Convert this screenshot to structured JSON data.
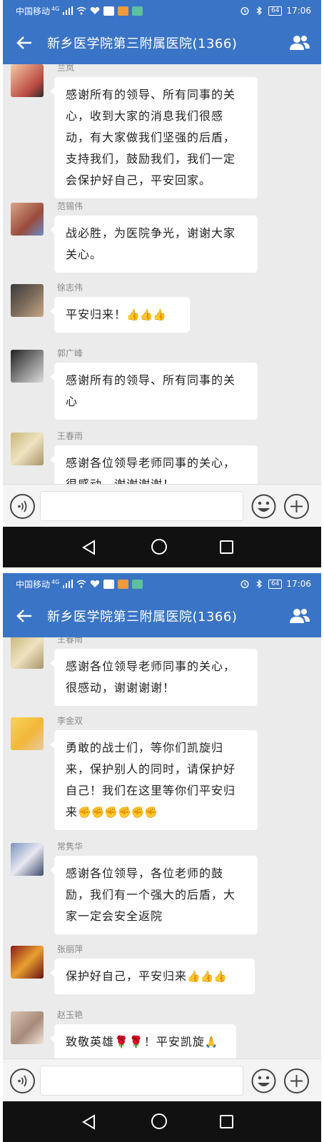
{
  "screens": [
    {
      "status": {
        "carrier": "中国移动",
        "net": "4G",
        "time": "17:06",
        "battery": "64"
      },
      "header": {
        "title": "新乡医学院第三附属医院(1366)"
      },
      "messages": [
        {
          "sender": "兰岚",
          "text": "感谢所有的领导、所有同事的关心，收到大家的消息我们很感动，有大家做我们坚强的后盾，支持我们，鼓励我们，我们一定会保护好自己，平安回家。",
          "emoji": ""
        },
        {
          "sender": "范锡伟",
          "text": "战必胜，为医院争光，谢谢大家关心。",
          "emoji": ""
        },
        {
          "sender": "徐志伟",
          "text": "平安归来！",
          "emoji": "👍👍👍"
        },
        {
          "sender": "郭广峰",
          "text": "感谢所有的领导、所有同事的关心",
          "emoji": ""
        },
        {
          "sender": "王春雨",
          "text": "感谢各位领导老师同事的关心，很感动，谢谢谢谢！",
          "emoji": ""
        }
      ]
    },
    {
      "status": {
        "carrier": "中国移动",
        "net": "4G",
        "time": "17:06",
        "battery": "64"
      },
      "header": {
        "title": "新乡医学院第三附属医院(1366)"
      },
      "messages": [
        {
          "sender": "王春雨",
          "text": "感谢各位领导老师同事的关心，很感动，谢谢谢谢！",
          "emoji": ""
        },
        {
          "sender": "李金双",
          "text": "勇敢的战士们，等你们凯旋归来，保护别人的同时，请保护好自己！我们在这里等你们平安归来",
          "emoji": "✊✊✊✊✊✊"
        },
        {
          "sender": "常隽华",
          "text": "感谢各位领导，各位老师的鼓励，我们有一个强大的后盾，大家一定会安全返院",
          "emoji": ""
        },
        {
          "sender": "张丽萍",
          "text": "保护好自己，平安归来",
          "emoji": "👍👍👍"
        },
        {
          "sender": "赵玉艳",
          "text": "致敬英雄🌹🌹！平安凯旋",
          "emoji": "🙏"
        }
      ]
    }
  ],
  "icons": {
    "back": "arrow-left-icon",
    "group": "group-members-icon",
    "voice": "voice-icon",
    "emoji": "smiley-icon",
    "plus": "plus-icon",
    "nav_back": "triangle-back-icon",
    "nav_home": "circle-home-icon",
    "nav_recent": "square-recent-icon"
  },
  "colors": {
    "header": "#3a74c6",
    "chat_bg": "#ebebeb",
    "bubble": "#ffffff",
    "navbar": "#111111"
  }
}
